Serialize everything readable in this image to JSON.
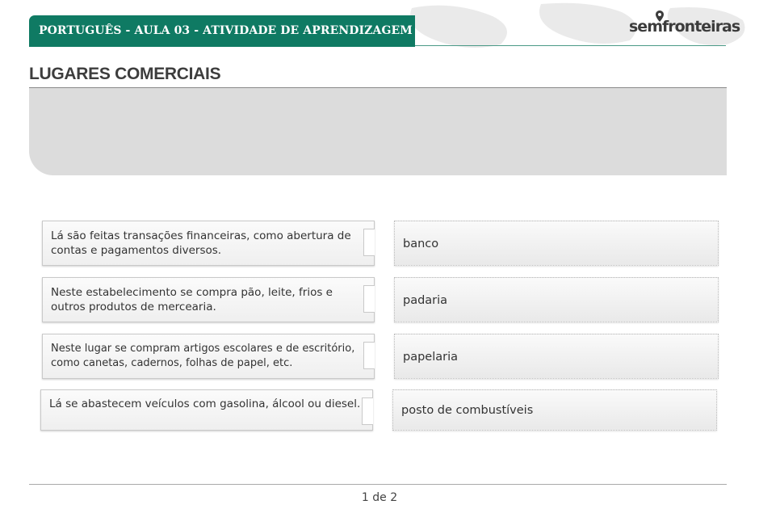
{
  "header": {
    "title": "PORTUGUÊS - AULA 03 - ATIVIDADE DE APRENDIZAGEM",
    "logo_text": "semfronteiras",
    "accent_color": "#0f7a63"
  },
  "section": {
    "title": "LUGARES COMERCIAIS"
  },
  "matching": {
    "rows": [
      {
        "description": "Lá são feitas transações financeiras, como abertura de contas e pagamentos diversos.",
        "answer": "banco"
      },
      {
        "description": "Neste estabelecimento se compra pão, leite,  frios e outros produtos de mercearia.",
        "answer": "padaria"
      },
      {
        "description": "Neste lugar se compram artigos escolares e de escritório, como canetas, cadernos, folhas de papel, etc.",
        "answer": "papelaria"
      },
      {
        "description": "Lá se abastecem veículos com gasolina, álcool ou diesel.",
        "answer": "posto de combustíveis"
      }
    ]
  },
  "footer": {
    "page_indicator": "1 de 2"
  }
}
